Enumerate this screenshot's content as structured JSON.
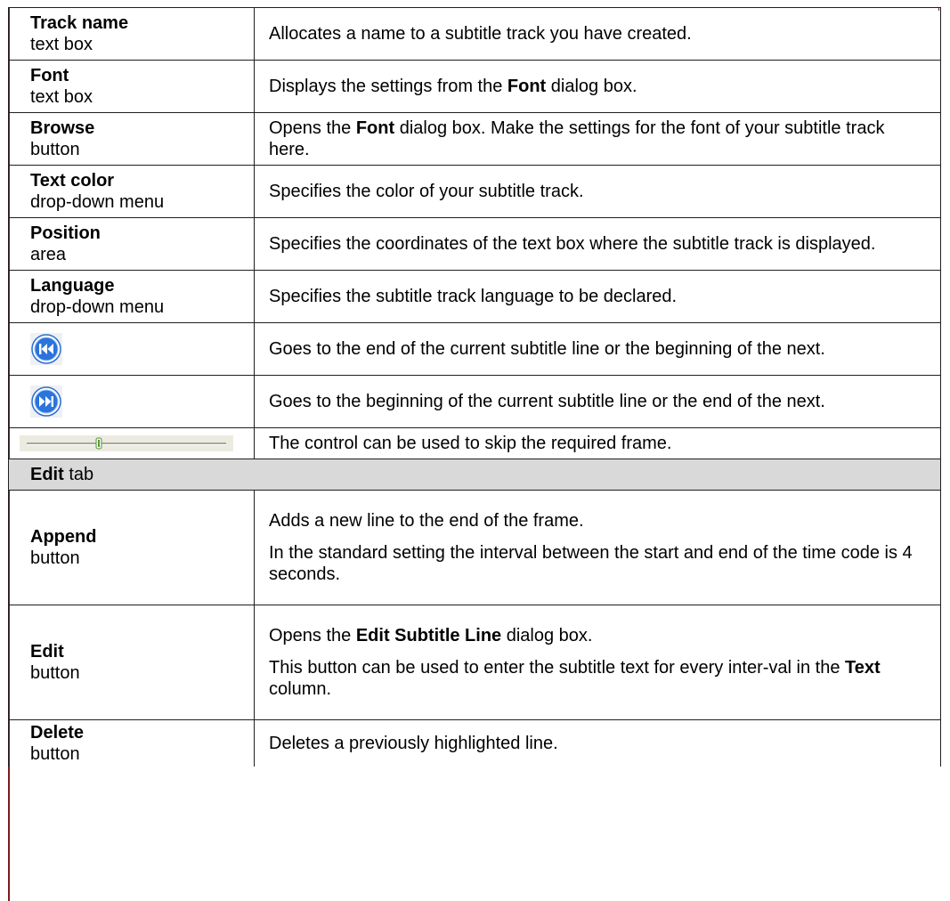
{
  "rows": [
    {
      "term": "Track name",
      "sub": "text box",
      "desc": [
        "Allocates a name to a subtitle track you have created."
      ]
    },
    {
      "term": "Font",
      "sub": "text box",
      "desc_pre": "Displays the settings from the ",
      "desc_bold": "Font",
      "desc_post": " dialog box."
    },
    {
      "term": "Browse",
      "sub": "button",
      "desc_pre": "Opens the ",
      "desc_bold": "Font",
      "desc_post": " dialog box. Make the settings for the font of your subtitle track here."
    },
    {
      "term": "Text color",
      "sub": "drop-down menu",
      "desc": [
        "Specifies the color of your subtitle track."
      ]
    },
    {
      "term": "Position",
      "sub": "area",
      "desc": [
        "Specifies the coordinates of the text box where the subtitle track is displayed."
      ]
    },
    {
      "term": "Language",
      "sub": "drop-down menu",
      "desc": [
        "Specifies the subtitle track language to be declared."
      ]
    },
    {
      "icon": "previous-line-icon",
      "desc": [
        "Goes to the end of the current subtitle line or the beginning of the next."
      ]
    },
    {
      "icon": "next-line-icon",
      "desc": [
        "Goes to the beginning of the current subtitle line or the end of the next."
      ]
    },
    {
      "icon": "frame-slider-icon",
      "desc": [
        "The control can be used to skip the required frame."
      ]
    }
  ],
  "section": {
    "bold": "Edit",
    "rest": " tab"
  },
  "edit_rows": [
    {
      "term": "Append",
      "sub": "button",
      "paras": [
        "Adds a new line to the end of the frame.",
        "In the standard setting the interval between the start and end of the time code is 4 seconds."
      ]
    },
    {
      "term": "Edit",
      "sub": "button",
      "p1_pre": "Opens the ",
      "p1_bold": "Edit Subtitle Line",
      "p1_post": " dialog box.",
      "p2_pre": "This button can be used to enter the subtitle text for every inter-val in the ",
      "p2_bold": "Text",
      "p2_post": " column."
    },
    {
      "term": "Delete",
      "sub": "button",
      "desc": "Deletes a previously highlighted line."
    }
  ],
  "colors": {
    "rule": "#7a1a1a",
    "section_bg": "#d9d9d9",
    "icon_blue": "#1f6fd6"
  }
}
